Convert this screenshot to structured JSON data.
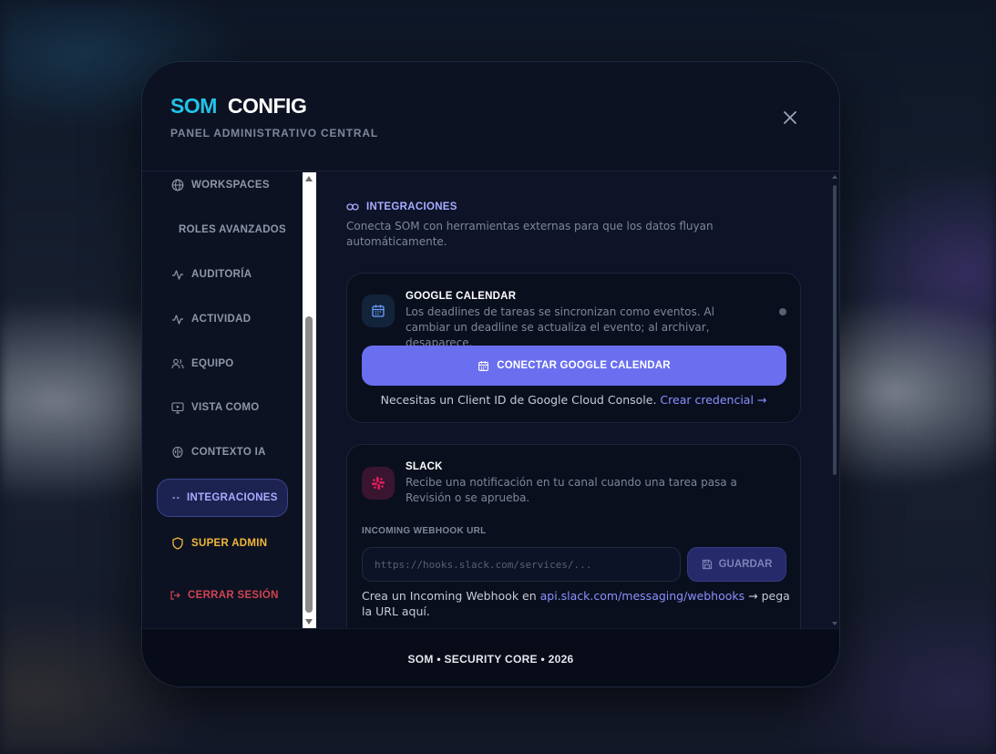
{
  "header": {
    "title_primary": "SOM",
    "title_secondary": "CONFIG",
    "subtitle": "PANEL ADMINISTRATIVO CENTRAL",
    "close_icon": "close-icon"
  },
  "sidebar": {
    "items": [
      {
        "label": "WORKSPACES",
        "icon": "globe-icon"
      },
      {
        "label": "ROLES AVANZADOS",
        "icon": ""
      },
      {
        "label": "AUDITORÍA",
        "icon": "activity-icon"
      },
      {
        "label": "ACTIVIDAD",
        "icon": "activity-icon"
      },
      {
        "label": "EQUIPO",
        "icon": "users-icon"
      },
      {
        "label": "VISTA COMO",
        "icon": "monitor-icon"
      },
      {
        "label": "CONTEXTO IA",
        "icon": "brain-icon"
      },
      {
        "label": "INTEGRACIONES",
        "icon": "link-icon",
        "active": true
      },
      {
        "label": "SUPER ADMIN",
        "icon": "shield-icon"
      },
      {
        "label": "CERRAR SESIÓN",
        "icon": "logout-icon"
      }
    ]
  },
  "main": {
    "section_title": "INTEGRACIONES",
    "section_desc": "Conecta SOM con herramientas externas para que los datos fluyan automáticamente.",
    "google": {
      "title": "GOOGLE CALENDAR",
      "desc": "Los deadlines de tareas se sincronizan como eventos. Al cambiar un deadline se actualiza el evento; al archivar, desaparece.",
      "button": "CONECTAR GOOGLE CALENDAR",
      "note": "Necesitas un Client ID de Google Cloud Console.",
      "note_link": "Crear credencial →"
    },
    "slack": {
      "title": "SLACK",
      "desc": "Recibe una notificación en tu canal cuando una tarea pasa a Revisión o se aprueba.",
      "field_label": "INCOMING WEBHOOK URL",
      "placeholder": "https://hooks.slack.com/services/...",
      "value": "",
      "save": "GUARDAR",
      "note_pre": "Crea un Incoming Webhook en",
      "note_link": "api.slack.com/messaging/webhooks",
      "note_post": "→ pega la URL aquí."
    }
  },
  "footer": {
    "text": "SOM • SECURITY CORE • 2026"
  },
  "colors": {
    "accent_cyan": "#22c3e8",
    "accent_indigo": "#6a6ff0",
    "super_admin": "#f1b838",
    "logout": "#d0434f",
    "slack": "#e01e5a"
  }
}
